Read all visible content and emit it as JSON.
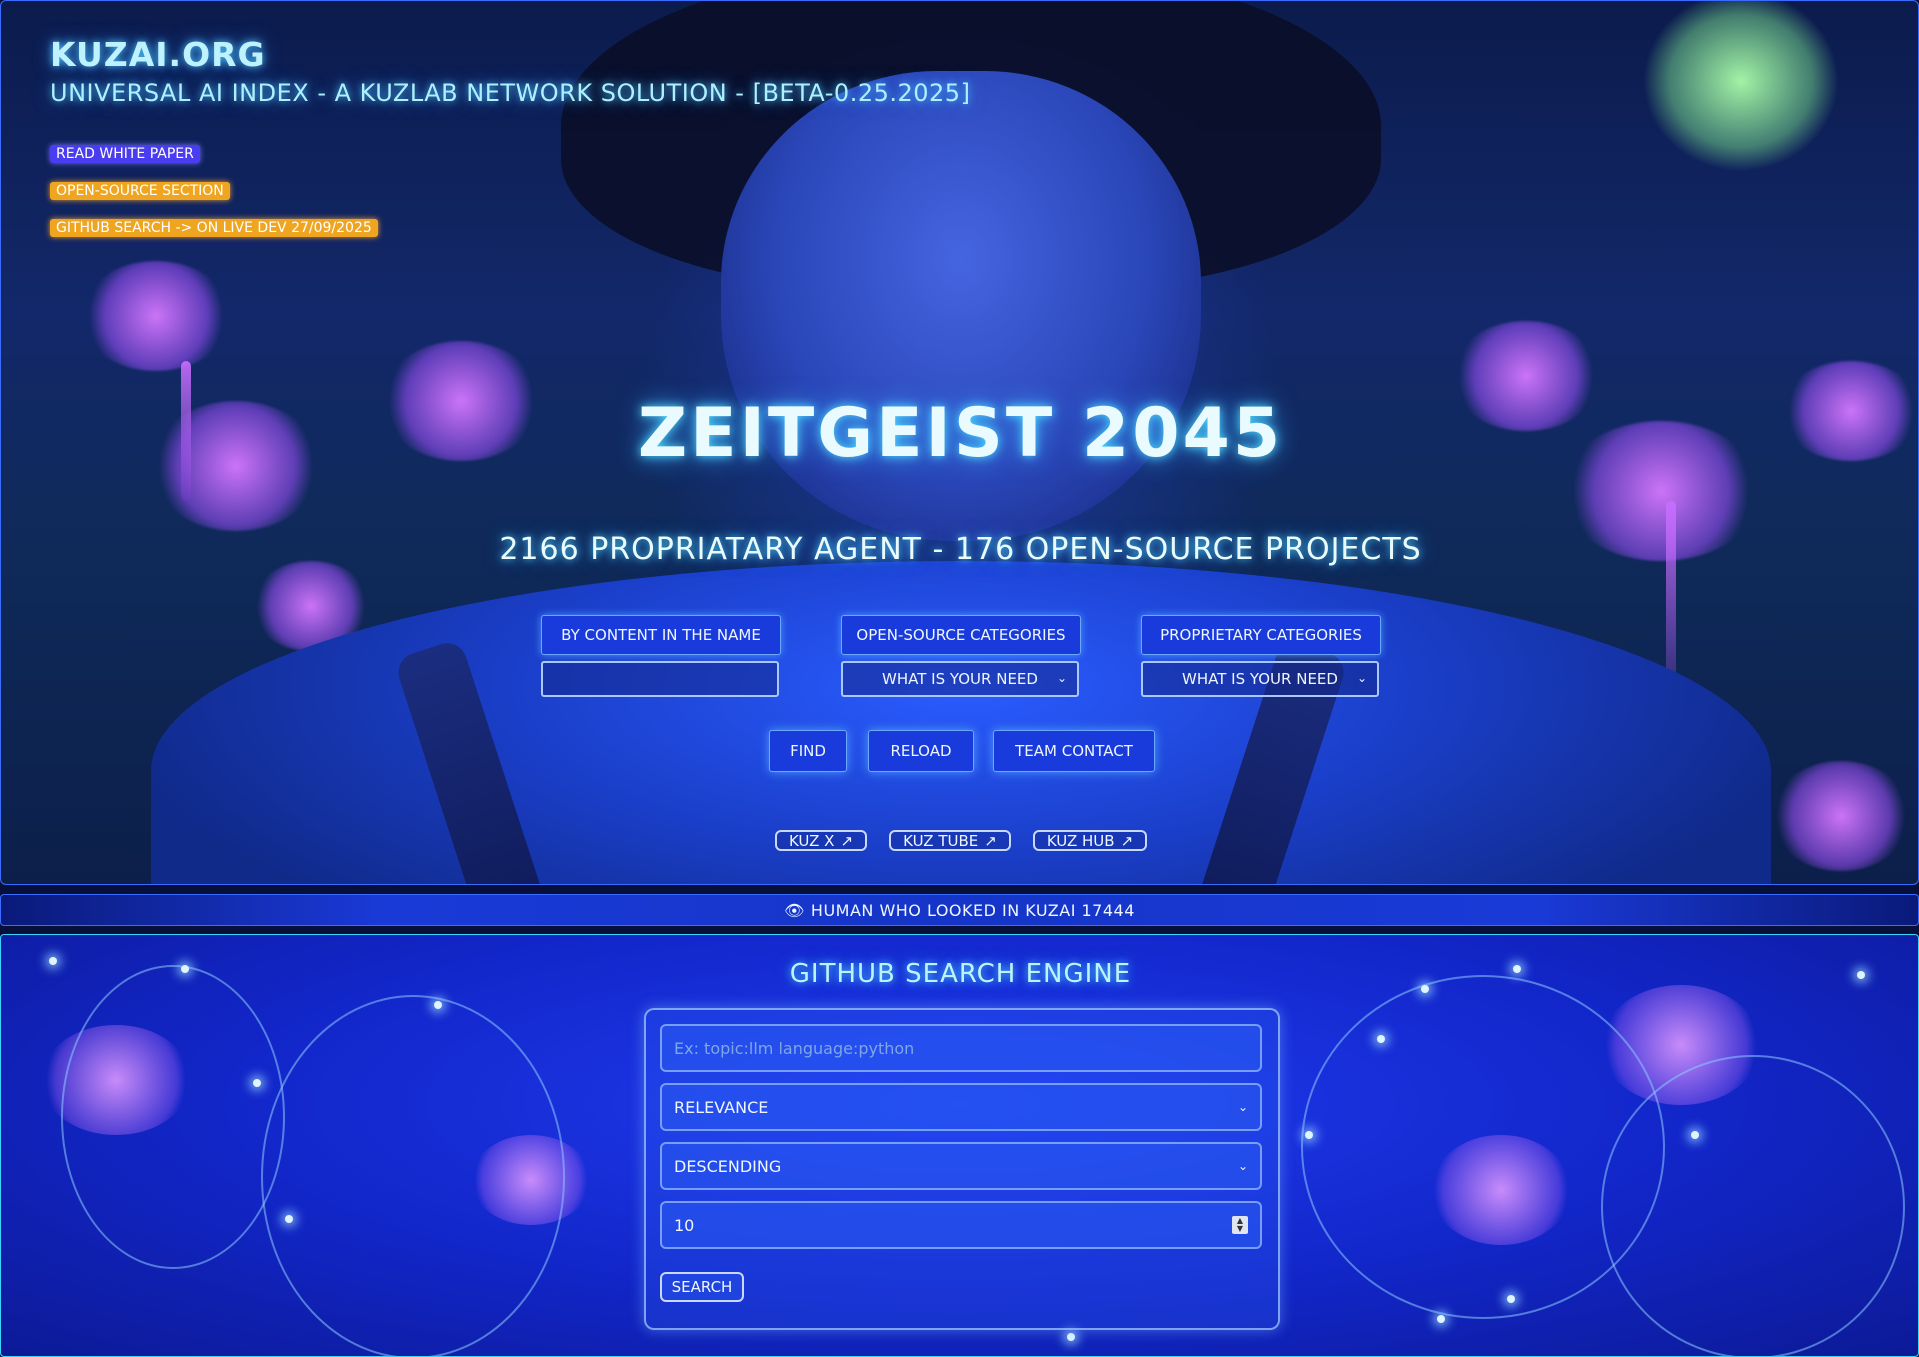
{
  "header": {
    "brand": "KUZAI.ORG",
    "subtitle": "UNIVERSAL AI INDEX - A KUZLAB NETWORK SOLUTION - [BETA-0.25.2025]",
    "pills": {
      "white_paper": "READ WHITE PAPER",
      "open_source": "OPEN-SOURCE SECTION",
      "github_search": "GITHUB SEARCH -> ON LIVE DEV 27/09/2025"
    }
  },
  "hero": {
    "title": "ZEITGEIST 2045",
    "counts": "2166 PROPRIATARY AGENT - 176 OPEN-SOURCE PROJECTS"
  },
  "filters": {
    "by_content_label": "BY CONTENT IN THE NAME",
    "by_content_value": "",
    "open_source_label": "OPEN-SOURCE CATEGORIES",
    "open_source_select": "WHAT IS YOUR NEED",
    "proprietary_label": "PROPRIETARY CATEGORIES",
    "proprietary_select": "WHAT IS YOUR NEED"
  },
  "actions": {
    "find": "FIND",
    "reload": "RELOAD",
    "team_contact": "TEAM CONTACT"
  },
  "links": {
    "kuz_x": "KUZ X",
    "kuz_tube": "KUZ TUBE",
    "kuz_hub": "KUZ HUB",
    "arrow": "↗"
  },
  "counter": {
    "icon": "👁",
    "text": "HUMAN WHO LOOKED IN KUZAI 17444"
  },
  "github": {
    "title": "GITHUB SEARCH ENGINE",
    "query_placeholder": "Ex: topic:llm language:python",
    "sort_value": "RELEVANCE",
    "order_value": "DESCENDING",
    "per_page_value": "10",
    "search_button": "SEARCH"
  },
  "icons": {
    "chevron": "chevron-down-icon",
    "external": "external-link-icon",
    "eye": "eye-icon"
  },
  "colors": {
    "accent": "#1a3bdc",
    "glow": "#50dcff",
    "pill_purple": "#4a3cf0",
    "pill_orange": "#f0a520"
  }
}
